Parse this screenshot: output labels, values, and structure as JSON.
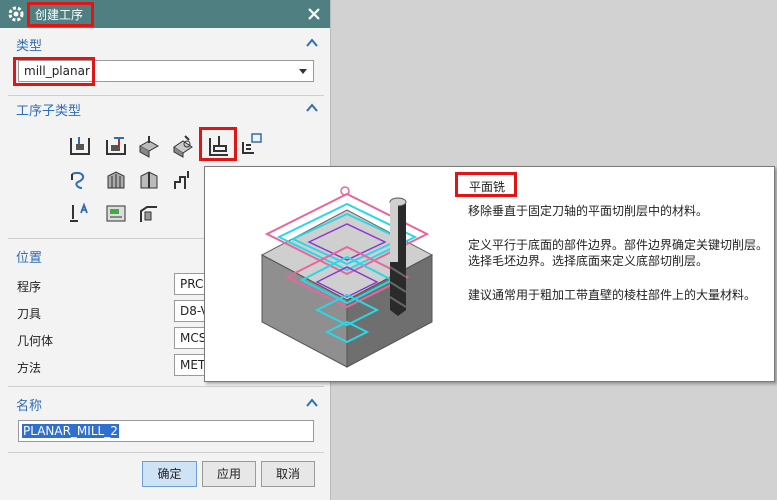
{
  "title": "创建工序",
  "sections": {
    "type": "类型",
    "subtype": "工序子类型",
    "location": "位置",
    "name": "名称"
  },
  "type_select": {
    "value": "mill_planar"
  },
  "location_fields": [
    {
      "label": "程序",
      "value": "PRC"
    },
    {
      "label": "刀具",
      "value": "D8-V"
    },
    {
      "label": "几何体",
      "value": "MCS"
    },
    {
      "label": "方法",
      "value": "MET"
    }
  ],
  "name_input": {
    "value": "PLANAR_MILL_2"
  },
  "buttons": {
    "ok": "确定",
    "apply": "应用",
    "cancel": "取消"
  },
  "subtype_icons": [
    "floor-wall-icon",
    "floor-wall-is-icon",
    "face-milling-icon",
    "face-milling-manual-icon",
    "planar-mill-icon",
    "planar-profile-icon",
    "cleanup-corners-icon",
    "finish-walls-icon",
    "finish-floor-icon",
    "groove-milling-icon",
    "planar-text-icon",
    "mill-control-icon",
    "mill-user-icon"
  ],
  "tooltip": {
    "title": "平面铣",
    "line1": "移除垂直于固定刀轴的平面切削层中的材料。",
    "line2": "定义平行于底面的部件边界。部件边界确定关键切削层。",
    "line3": "选择毛坯边界。选择底面来定义底部切削层。",
    "line4": "建议通常用于粗加工带直壁的棱柱部件上的大量材料。"
  },
  "colors": {
    "titlebar": "#4f7f80",
    "section_title": "#2f6db5",
    "highlight": "#e11515",
    "selection": "#2f6fd0"
  }
}
